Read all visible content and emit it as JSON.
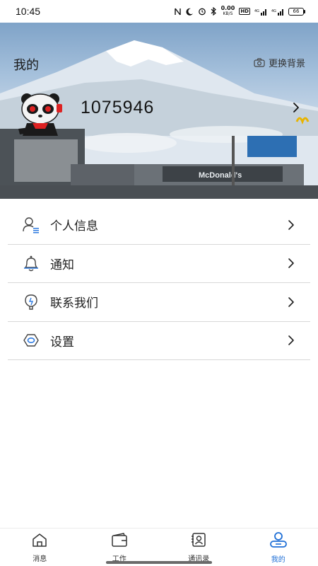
{
  "status_bar": {
    "time": "10:45",
    "net_speed_value": "0.00",
    "net_speed_unit": "KB/S",
    "hd_label": "HD",
    "signal_1_label": "4G",
    "signal_2_label": "4G",
    "battery": "66"
  },
  "header": {
    "title": "我的",
    "change_bg_label": "更换背景",
    "user_id": "1075946",
    "sign_text": "McDonald's"
  },
  "menu": {
    "items": [
      {
        "label": "个人信息",
        "icon": "user-info-icon"
      },
      {
        "label": "通知",
        "icon": "bell-icon"
      },
      {
        "label": "联系我们",
        "icon": "contact-icon"
      },
      {
        "label": "设置",
        "icon": "settings-icon"
      }
    ]
  },
  "tabbar": {
    "tabs": [
      {
        "label": "消息",
        "icon": "home-icon"
      },
      {
        "label": "工作",
        "icon": "wallet-icon"
      },
      {
        "label": "通讯录",
        "icon": "contacts-book-icon"
      },
      {
        "label": "我的",
        "icon": "profile-icon"
      }
    ],
    "active_index": 3
  },
  "colors": {
    "accent": "#1f6fd6",
    "text": "#1e1e1e",
    "divider": "#d8d8d8"
  }
}
